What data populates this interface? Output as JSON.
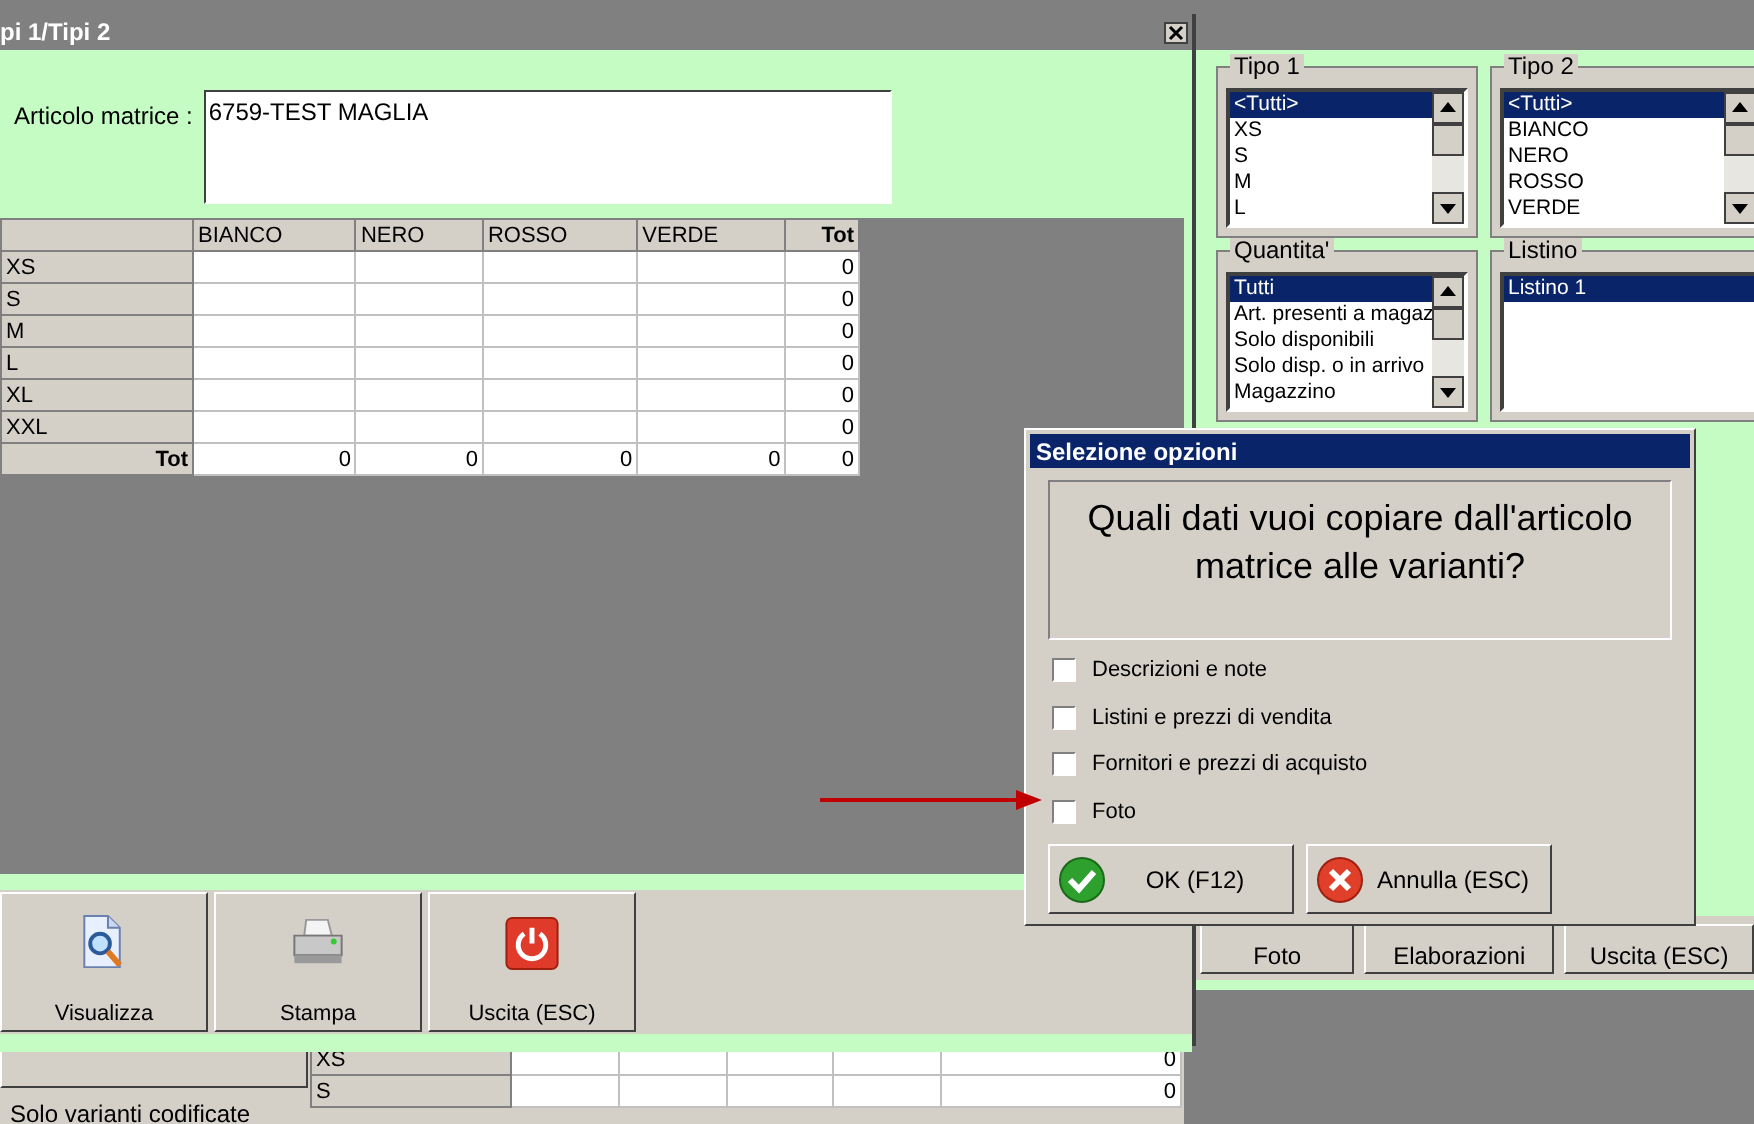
{
  "bottom_window": {
    "option_label": "Solo varianti codificate",
    "grid_rows": [
      {
        "label": "XS",
        "total": "0"
      },
      {
        "label": "S",
        "total": "0"
      }
    ]
  },
  "side_window": {
    "filters": [
      {
        "title": "Tipo 1",
        "kind": "scroll",
        "items": [
          {
            "label": "<Tutti>",
            "selected": true
          },
          {
            "label": "XS",
            "selected": false
          },
          {
            "label": "S",
            "selected": false
          },
          {
            "label": "M",
            "selected": false
          },
          {
            "label": "L",
            "selected": false
          }
        ]
      },
      {
        "title": "Tipo 2",
        "kind": "scroll",
        "items": [
          {
            "label": "<Tutti>",
            "selected": true
          },
          {
            "label": "BIANCO",
            "selected": false
          },
          {
            "label": "NERO",
            "selected": false
          },
          {
            "label": "ROSSO",
            "selected": false
          },
          {
            "label": "VERDE",
            "selected": false
          }
        ]
      },
      {
        "title": "Quantita'",
        "kind": "scroll",
        "items": [
          {
            "label": "Tutti",
            "selected": true
          },
          {
            "label": "Art. presenti a magaz",
            "selected": false
          },
          {
            "label": "Solo disponibili",
            "selected": false
          },
          {
            "label": "Solo disp. o in arrivo",
            "selected": false
          },
          {
            "label": "Magazzino",
            "selected": false
          }
        ]
      },
      {
        "title": "Listino",
        "kind": "plain",
        "items": [
          {
            "label": "Listino 1",
            "selected": true
          }
        ]
      }
    ],
    "buttons": [
      "Foto",
      "Elaborazioni",
      "Uscita (ESC)"
    ]
  },
  "main_window": {
    "title": "pi 1/Tipi 2",
    "matrix_label": "Articolo matrice :",
    "matrix_value": "6759-TEST MAGLIA",
    "grid": {
      "columns": [
        "BIANCO",
        "NERO",
        "ROSSO",
        "VERDE",
        "Tot"
      ],
      "rows": [
        {
          "label": "XS",
          "total": "0"
        },
        {
          "label": "S",
          "total": "0"
        },
        {
          "label": "M",
          "total": "0"
        },
        {
          "label": "L",
          "total": "0"
        },
        {
          "label": "XL",
          "total": "0"
        },
        {
          "label": "XXL",
          "total": "0"
        }
      ],
      "footer": {
        "label": "Tot",
        "cells": [
          "0",
          "0",
          "0",
          "0",
          "0"
        ]
      }
    },
    "toolbar": [
      {
        "label": "Visualizza",
        "kind": "view"
      },
      {
        "label": "Stampa",
        "kind": "print"
      },
      {
        "label": "Uscita (ESC)",
        "kind": "exit"
      }
    ]
  },
  "dialog": {
    "title": "Selezione opzioni",
    "message": "Quali dati vuoi copiare dall'articolo matrice alle varianti?",
    "options": [
      {
        "label": "Descrizioni e note",
        "checked": false
      },
      {
        "label": "Listini e prezzi di vendita",
        "checked": false
      },
      {
        "label": "Fornitori e prezzi di acquisto",
        "checked": false
      },
      {
        "label": "Foto",
        "checked": false
      }
    ],
    "buttons": [
      {
        "label": "OK (F12)",
        "kind": "ok"
      },
      {
        "label": "Annulla (ESC)",
        "kind": "cancel"
      }
    ]
  }
}
